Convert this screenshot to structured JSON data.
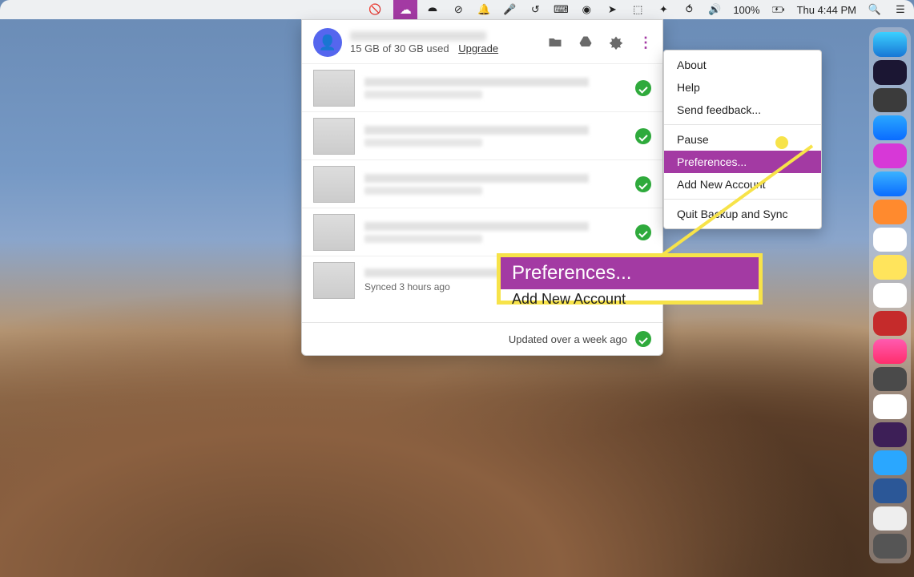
{
  "menubar": {
    "battery_text": "100%",
    "clock_text": "Thu 4:44 PM"
  },
  "panel": {
    "storage_text": "15 GB of 30 GB used",
    "upgrade_label": "Upgrade",
    "items": [
      {
        "meta": ""
      },
      {
        "meta": ""
      },
      {
        "meta": ""
      },
      {
        "meta": ""
      },
      {
        "meta": "Synced 3 hours ago"
      }
    ],
    "footer_text": "Updated over a week ago"
  },
  "settings_menu": {
    "items": [
      {
        "label": "About",
        "highlight": false
      },
      {
        "label": "Help",
        "highlight": false
      },
      {
        "label": "Send feedback...",
        "highlight": false
      },
      {
        "sep": true
      },
      {
        "label": "Pause",
        "highlight": false
      },
      {
        "label": "Preferences...",
        "highlight": true
      },
      {
        "label": "Add New Account",
        "highlight": false
      },
      {
        "sep": true
      },
      {
        "label": "Quit Backup and Sync",
        "highlight": false
      }
    ]
  },
  "callout": {
    "big_label": "Preferences...",
    "small_label": "Add New Account"
  },
  "colors": {
    "accent": "#a33aa3",
    "highlight_yellow": "#f7e349",
    "success": "#2faa3c"
  }
}
